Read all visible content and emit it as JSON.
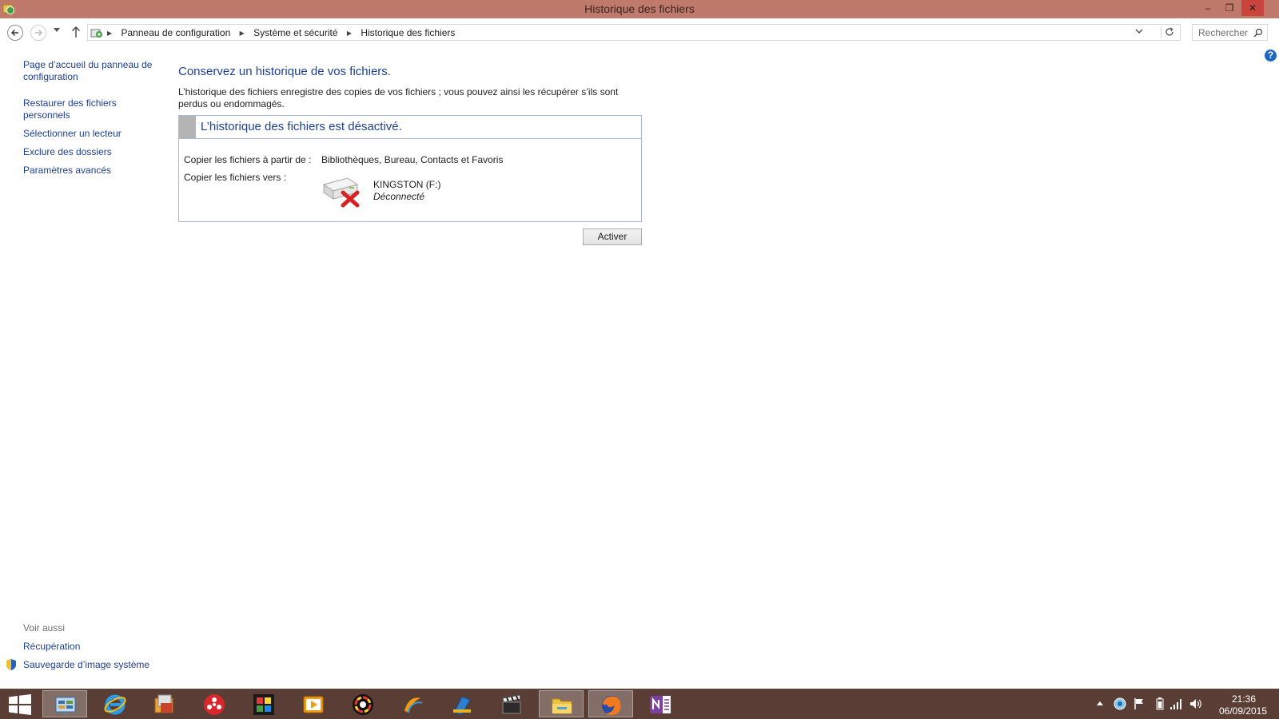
{
  "window": {
    "title": "Historique des fichiers",
    "minimize_glyph": "–",
    "maximize_glyph": "❐",
    "close_glyph": "✕"
  },
  "address": {
    "breadcrumbs": [
      "Panneau de configuration",
      "Système et sécurité",
      "Historique des fichiers"
    ],
    "separator": "▶",
    "search_placeholder": "Rechercher"
  },
  "help": {
    "glyph": "?"
  },
  "leftnav": {
    "home": "Page d’accueil du panneau de configuration",
    "restore": "Restaurer des fichiers personnels",
    "select_drive": "Sélectionner un lecteur",
    "exclude": "Exclure des dossiers",
    "advanced": "Paramètres avancés",
    "see_also_label": "Voir aussi",
    "recovery": "Récupération",
    "system_image": "Sauvegarde d’image système"
  },
  "main": {
    "title": "Conservez un historique de vos fichiers.",
    "description": "L’historique des fichiers enregistre des copies de vos fichiers ; vous pouvez ainsi les récupérer s’ils sont perdus ou endommagés.",
    "status_header": "L’historique des fichiers est désactivé.",
    "copy_from_label": "Copier les fichiers à partir de :",
    "copy_from_value": "Bibliothèques, Bureau, Contacts et Favoris",
    "copy_to_label": "Copier les fichiers vers :",
    "drive_name": "KINGSTON (F:)",
    "drive_status": "Déconnecté",
    "activate_button": "Activer"
  },
  "taskbar": {
    "apps": [
      "control-panel",
      "internet-explorer",
      "file-history",
      "hub",
      "gallery",
      "media-player",
      "color-app",
      "music-app",
      "paint-app",
      "video-app",
      "file-explorer",
      "firefox",
      "onenote"
    ],
    "time": "21:36",
    "date": "06/09/2015"
  },
  "colors": {
    "titlebar": "#c07a6b",
    "taskbar": "#5a3e35",
    "link": "#1c3f94",
    "close_button": "#c8443c"
  }
}
